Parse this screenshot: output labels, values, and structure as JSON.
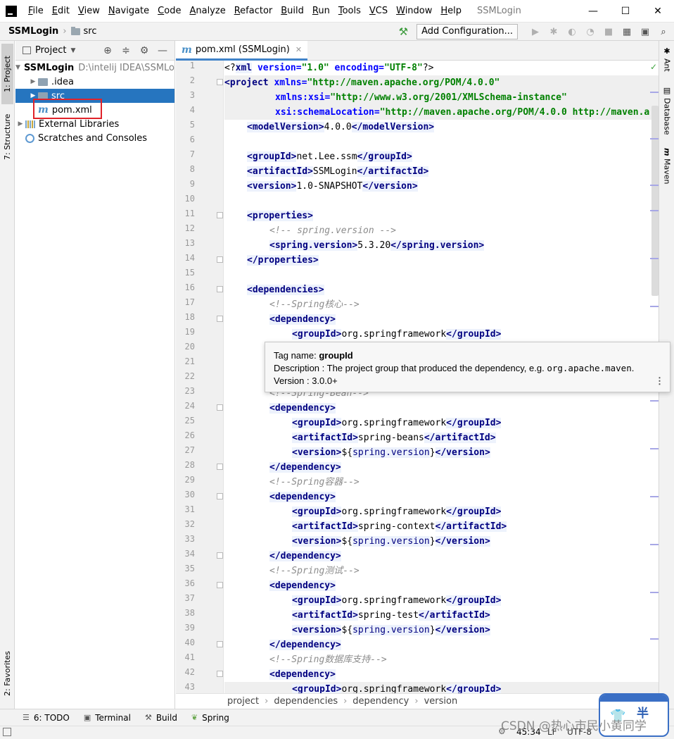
{
  "window": {
    "title": "SSMLogin",
    "menu": [
      "File",
      "Edit",
      "View",
      "Navigate",
      "Code",
      "Analyze",
      "Refactor",
      "Build",
      "Run",
      "Tools",
      "VCS",
      "Window",
      "Help"
    ],
    "controls": {
      "minimize": "—",
      "maximize": "☐",
      "close": "✕"
    }
  },
  "navbar": {
    "project": "SSMLogin",
    "folder": "src",
    "add_config": "Add Configuration..."
  },
  "left_strip": {
    "project_tab": "1: Project",
    "structure_tab": "7: Structure",
    "favorites_tab": "2: Favorites"
  },
  "right_strip": {
    "ant": "Ant",
    "database": "Database",
    "maven": "Maven"
  },
  "project_panel": {
    "title": "Project",
    "tree": [
      {
        "label": "SSMLogin",
        "path": "D:\\intelij IDEA\\SSMLo",
        "icon": "folder-icon"
      },
      {
        "label": ".idea",
        "icon": "folder-icon"
      },
      {
        "label": "src",
        "icon": "folder-icon"
      },
      {
        "label": "pom.xml",
        "icon": "maven-file-icon"
      },
      {
        "label": "External Libraries",
        "icon": "library-icon"
      },
      {
        "label": "Scratches and Consoles",
        "icon": "scratch-icon"
      }
    ]
  },
  "editor": {
    "tab": "pom.xml (SSMLogin)",
    "line_numbers": [
      "1",
      "2",
      "3",
      "4",
      "5",
      "6",
      "7",
      "8",
      "9",
      "10",
      "11",
      "12",
      "13",
      "14",
      "15",
      "16",
      "17",
      "18",
      "19",
      "20",
      "21",
      "22",
      "23",
      "24",
      "25",
      "26",
      "27",
      "28",
      "29",
      "30",
      "31",
      "32",
      "33",
      "34",
      "35",
      "36",
      "37",
      "38",
      "39",
      "40",
      "41",
      "42",
      "43"
    ],
    "code": {
      "l1": {
        "a": "<?",
        "b": "xml",
        "c": " version=",
        "d": "\"1.0\"",
        "e": " encoding=",
        "f": "\"UTF-8\"",
        "g": "?>"
      },
      "l2": {
        "a": "<project ",
        "b": "xmlns=",
        "c": "\"http://maven.apache.org/POM/4.0.0\""
      },
      "l3": {
        "a": "xmlns:xsi=",
        "b": "\"http://www.w3.org/2001/XMLSchema-instance\""
      },
      "l4": {
        "a": "xsi:schemaLocation=",
        "b": "\"http://maven.apache.org/POM/4.0.0 http://maven.a"
      },
      "l5": {
        "open": "<modelVersion>",
        "text": "4.0.0",
        "close": "</modelVersion>"
      },
      "l7": {
        "open": "<groupId>",
        "text": "net.Lee.ssm",
        "close": "</groupId>"
      },
      "l8": {
        "open": "<artifactId>",
        "text": "SSMLogin",
        "close": "</artifactId>"
      },
      "l9": {
        "open": "<version>",
        "text": "1.0-SNAPSHOT",
        "close": "</version>"
      },
      "l11": "<properties>",
      "l12": "<!-- spring.version -->",
      "l13": {
        "open": "<spring.version>",
        "text": "5.3.20",
        "close": "</spring.version>"
      },
      "l14": "</properties>",
      "l16": "<dependencies>",
      "l17": "<!--Spring核心-->",
      "l18": "<dependency>",
      "l19": {
        "open": "<groupId>",
        "text": "org.springframework",
        "close": "</groupId>"
      },
      "l23": "<!--Spring-Bean-->",
      "l24": "<dependency>",
      "l25": {
        "open": "<groupId>",
        "text": "org.springframework",
        "close": "</groupId>"
      },
      "l26": {
        "open": "<artifactId>",
        "text": "spring-beans",
        "close": "</artifactId>"
      },
      "l27": {
        "open": "<version>",
        "text": "${",
        "prop": "spring.version",
        "text2": "}",
        "close": "</version>"
      },
      "l28": "</dependency>",
      "l29": "<!--Spring容器-->",
      "l30": "<dependency>",
      "l31": {
        "open": "<groupId>",
        "text": "org.springframework",
        "close": "</groupId>"
      },
      "l32": {
        "open": "<artifactId>",
        "text": "spring-context",
        "close": "</artifactId>"
      },
      "l33": {
        "open": "<version>",
        "text": "${",
        "prop": "spring.version",
        "text2": "}",
        "close": "</version>"
      },
      "l34": "</dependency>",
      "l35": "<!--Spring测试-->",
      "l36": "<dependency>",
      "l37": {
        "open": "<groupId>",
        "text": "org.springframework",
        "close": "</groupId>"
      },
      "l38": {
        "open": "<artifactId>",
        "text": "spring-test",
        "close": "</artifactId>"
      },
      "l39": {
        "open": "<version>",
        "text": "${",
        "prop": "spring.version",
        "text2": "}",
        "close": "</version>"
      },
      "l40": "</dependency>",
      "l41": "<!--Spring数据库支持-->",
      "l42": "<dependency>",
      "l43": {
        "open": "<groupId>",
        "text": "org.springframework",
        "close": "</groupId>"
      }
    }
  },
  "tooltip": {
    "tag_label": "Tag name: ",
    "tag_name": "groupId",
    "desc_label": "Description : The project group that produced the dependency, e.g. ",
    "desc_code": "org.apache.maven",
    "desc_end": ".",
    "version": "Version : 3.0.0+"
  },
  "breadcrumbs": [
    "project",
    "dependencies",
    "dependency",
    "version"
  ],
  "bottom_tabs": [
    {
      "label": "6: TODO",
      "icon": "list-icon"
    },
    {
      "label": "Terminal",
      "icon": "terminal-icon"
    },
    {
      "label": "Build",
      "icon": "hammer-icon"
    },
    {
      "label": "Spring",
      "icon": "leaf-icon"
    }
  ],
  "status": {
    "position": "45:34",
    "line_sep": "LF",
    "encoding": "UTF-8"
  },
  "watermark": "CSDN @热心市民小黄同学",
  "badge_text": "半",
  "colors": {
    "accent": "#2675bf",
    "tag": "#000080",
    "string": "#008000",
    "attr": "#0000ff",
    "comment": "#8c8c8c",
    "highlight_box": "#e0222a"
  }
}
